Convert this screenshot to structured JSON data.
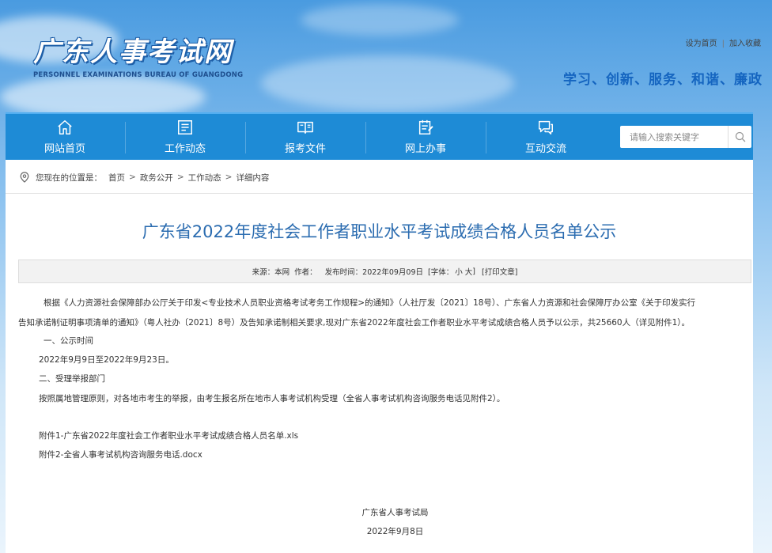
{
  "header": {
    "logo_title": "广东人事考试网",
    "logo_subtitle": "PERSONNEL EXAMINATIONS BUREAU OF GUANGDONG",
    "top_links": [
      "设为首页",
      "加入收藏"
    ],
    "top_links_separator": "|",
    "slogan": "学习、创新、服务、和谐、廉政"
  },
  "nav": {
    "items": [
      {
        "label": "网站首页",
        "icon": "home-icon"
      },
      {
        "label": "工作动态",
        "icon": "newspaper-icon"
      },
      {
        "label": "报考文件",
        "icon": "book-icon"
      },
      {
        "label": "网上办事",
        "icon": "clipboard-icon"
      },
      {
        "label": "互动交流",
        "icon": "chat-icon"
      }
    ],
    "search": {
      "placeholder": "请输入搜索关键字",
      "icon": "search-icon"
    }
  },
  "breadcrumb": {
    "prefix": "您现在的位置是：",
    "items": [
      "首页",
      "政务公开",
      "工作动态",
      "详细内容"
    ],
    "separator": ">",
    "icon": "location-pin-icon"
  },
  "article": {
    "title": "广东省2022年度社会工作者职业水平考试成绩合格人员名单公示",
    "meta": {
      "source_label": "来源：",
      "source_value": "本网",
      "author_label": "作者：",
      "author_value": "",
      "date_label": "发布时间：",
      "date_value": "2022年09月09日",
      "font_label": "[字体：",
      "font_small": "小",
      "font_large": "大",
      "font_close": "]",
      "print_label": "[打印文章]"
    },
    "paragraph_line1": "根据《人力资源社会保障部办公厅关于印发<专业技术人员职业资格考试考务工作规程>的通知》（人社厅发〔2021〕18号）、广东省人力资源和社会保障厅办公室《关于印发实行",
    "paragraph_line2": "告知承诺制证明事项清单的通知》（粤人社办〔2021〕8号）及告知承诺制相关要求,现对广东省2022年度社会工作者职业水平考试成绩合格人员予以公示，共25660人（详见附件1）。",
    "section1_heading": "一、公示时间",
    "section1_text": "2022年9月9日至2022年9月23日。",
    "section2_heading": "二、受理举报部门",
    "section2_text": "按照属地管理原则，对各地市考生的举报，由考生报名所在地市人事考试机构受理（全省人事考试机构咨询服务电话见附件2）。",
    "attachments": [
      "附件1-广东省2022年度社会工作者职业水平考试成绩合格人员名单.xls",
      "附件2-全省人事考试机构咨询服务电话.docx"
    ],
    "signature_org": "广东省人事考试局",
    "signature_date": "2022年9月8日"
  },
  "colors": {
    "nav_bg": "#1e8bd6",
    "title_blue": "#2b6cb0",
    "slogan_blue": "#1565c0"
  }
}
